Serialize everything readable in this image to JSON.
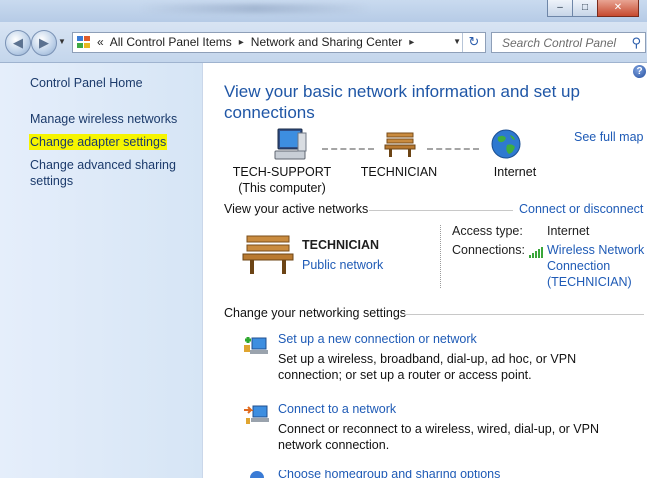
{
  "window": {
    "minimize": "–",
    "maximize": "□",
    "close": "✕"
  },
  "nav": {
    "back_icon": "back-arrow-icon",
    "forward_icon": "forward-arrow-icon",
    "chevrons": "«",
    "breadcrumbs": [
      "All Control Panel Items",
      "Network and Sharing Center"
    ],
    "separator": "▸",
    "search_placeholder": "Search Control Panel"
  },
  "sidebar": {
    "items": [
      {
        "label": "Control Panel Home"
      },
      {
        "label": "Manage wireless networks"
      },
      {
        "label": "Change adapter settings",
        "highlighted": true
      },
      {
        "label": "Change advanced sharing settings"
      }
    ]
  },
  "main": {
    "help": "?",
    "heading": "View your basic network information and set up connections",
    "see_full_map": "See full map",
    "map": {
      "computer_name": "TECH-SUPPORT",
      "computer_sub": "(This computer)",
      "network": "TECHNICIAN",
      "internet": "Internet"
    },
    "active_networks": {
      "title": "View your active networks",
      "connect_link": "Connect or disconnect",
      "network_name": "TECHNICIAN",
      "network_type": "Public network",
      "access_type_label": "Access type:",
      "access_type_value": "Internet",
      "connections_label": "Connections:",
      "connection_link": "Wireless Network Connection (TECHNICIAN)"
    },
    "change_settings": {
      "title": "Change your networking settings",
      "tasks": [
        {
          "title": "Set up a new connection or network",
          "desc": "Set up a wireless, broadband, dial-up, ad hoc, or VPN connection; or set up a router or access point."
        },
        {
          "title": "Connect to a network",
          "desc": "Connect or reconnect to a wireless, wired, dial-up, or VPN network connection."
        },
        {
          "title": "Choose homegroup and sharing options"
        }
      ]
    }
  },
  "colors": {
    "link": "#1f5bb6",
    "heading": "#1f56a6",
    "highlight": "#f6f500"
  }
}
